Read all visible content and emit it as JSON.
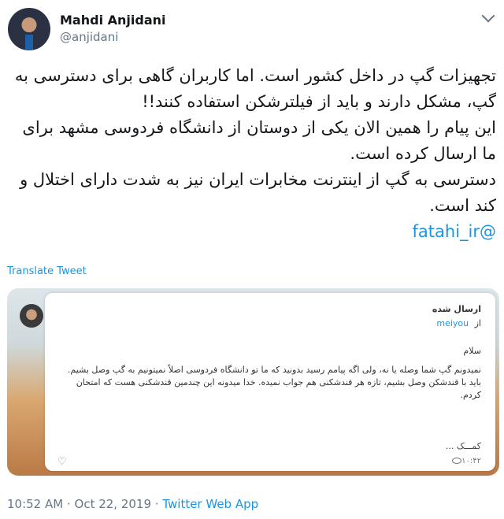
{
  "author": {
    "name": "Mahdi Anjidani",
    "handle": "@anjidani"
  },
  "tweet": {
    "lines": [
      "تجهیزات گپ در داخل کشور است. اما کاربران گاهی برای دسترسی به گپ، مشکل دارند و باید از فیلترشکن استفاده کنند!!",
      "این پیام را همین الان یکی از دوستان از دانشگاه فردوسی مشهد برای ما ارسال کرده است.",
      "دسترسی به گپ از اینترنت مخابرات ایران نیز به شدت دارای اختلال و کند است."
    ],
    "mention": "@fatahi_ir"
  },
  "translate_label": "Translate Tweet",
  "media": {
    "sent_label": "ارسال شده",
    "from_prefix": "از",
    "from_user": "meiyou",
    "greeting": "سلام",
    "message_lines": [
      "نمیدونم گپ شما وصله یا نه، ولی اگه پیامم رسید بدونید که ما تو دانشگاه فردوسی اصلاً نمیتونیم به گپ وصل بشیم.",
      "باید با قندشکن وصل بشیم، تازه هر قندشکنی هم جواب نمیده. خدا میدونه این چندمین قندشکنی هست که امتحان کردم."
    ],
    "help_text": "کمـــک ...",
    "time": "۱۰:۴۲"
  },
  "footer": {
    "time": "10:52 AM",
    "separator1": " · ",
    "date": "Oct 22, 2019",
    "separator2": " · ",
    "via": "Twitter Web App"
  }
}
